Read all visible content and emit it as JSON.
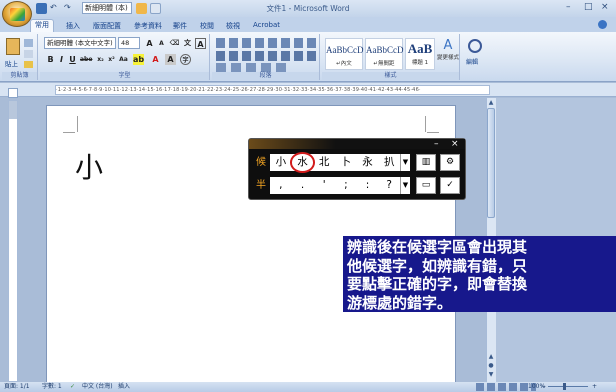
{
  "window": {
    "title": "文件1 - Microsoft Word"
  },
  "qat": {
    "font_box": "新細明體 (本)"
  },
  "tabs": [
    "常用",
    "插入",
    "版面配置",
    "參考資料",
    "郵件",
    "校閱",
    "檢視",
    "Acrobat"
  ],
  "ribbon": {
    "clipboard": {
      "label": "剪貼簿",
      "paste": "貼上"
    },
    "font": {
      "label": "字型",
      "font_name": "新細明體 (本文中文字)",
      "font_size": "48"
    },
    "paragraph": {
      "label": "段落"
    },
    "styles": {
      "label": "樣式",
      "items": [
        {
          "sample": "AaBbCcD",
          "name": "↵內文"
        },
        {
          "sample": "AaBbCcD",
          "name": "↵無間距"
        },
        {
          "sample": "AaB",
          "name": "標題 1"
        }
      ],
      "change": "變更樣式"
    },
    "editing": {
      "label": "編輯"
    }
  },
  "ruler": {
    "marks": "·1·2·3·4·5·6·7·8·9·10·11·12·13·14·15·16·17·18·19·20·21·22·23·24·25·26·27·28·29·30·31·32·33·34·35·36·37·38·39·40·41·42·43·44·45·46·"
  },
  "document": {
    "handwritten": "小"
  },
  "ime": {
    "row1": {
      "label": "候",
      "candidates": [
        "小",
        "水",
        "北",
        "卜",
        "永",
        "扒"
      ],
      "selected_index": 1,
      "arrow": "▼",
      "icon1": "▥",
      "icon2": "⚙"
    },
    "row2": {
      "label": "半",
      "candidates": [
        ",",
        ".",
        "'",
        ";",
        ":",
        "?"
      ],
      "arrow": "▼",
      "icon1": "▭",
      "icon2": "✓"
    },
    "close": "×",
    "minimize": "–"
  },
  "callout": {
    "text": "辨識後在候選字區會出現其\n他候選字，如辨識有錯，只\n要點擊正確的字，即會替換\n游標處的錯字。"
  },
  "status": {
    "page": "頁面: 1/1",
    "words": "字數: 1",
    "language": "中文 (台灣)",
    "mode": "插入",
    "zoom": "100%"
  }
}
